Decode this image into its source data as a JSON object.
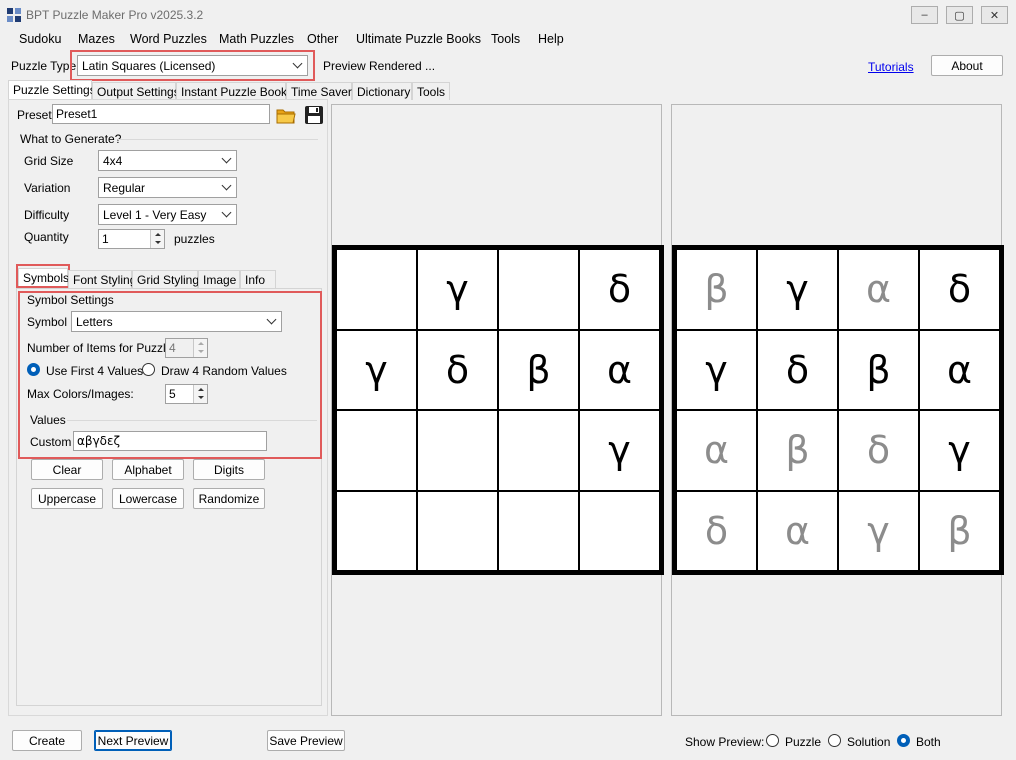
{
  "window": {
    "title": "BPT Puzzle Maker Pro v2025.3.2",
    "minimize": "–",
    "maximize": "▢",
    "close": "✕"
  },
  "menu": [
    "Sudoku",
    "Mazes",
    "Word Puzzles",
    "Math Puzzles",
    "Other",
    "Ultimate Puzzle Books",
    "Tools",
    "Help"
  ],
  "puzzle_type": {
    "label": "Puzzle Type",
    "value": "Latin Squares (Licensed)",
    "status": "Preview Rendered ...",
    "tutorials": "Tutorials",
    "about": "About"
  },
  "main_tabs": [
    "Puzzle Settings",
    "Output Settings",
    "Instant Puzzle Books",
    "Time Saver",
    "Dictionary",
    "Tools"
  ],
  "preset": {
    "label": "Preset",
    "value": "Preset1"
  },
  "generate": {
    "group_title": "What to Generate?",
    "grid_size_label": "Grid Size",
    "grid_size": "4x4",
    "variation_label": "Variation",
    "variation": "Regular",
    "difficulty_label": "Difficulty",
    "difficulty": "Level 1 - Very Easy",
    "quantity_label": "Quantity",
    "quantity": "1",
    "quantity_unit": "puzzles"
  },
  "sub_tabs": [
    "Symbols",
    "Font Styling",
    "Grid Styling",
    "Image",
    "Info"
  ],
  "symbols": {
    "group_title": "Symbol Settings",
    "symbol_label": "Symbol",
    "symbol": "Letters",
    "items_label": "Number of Items for Puzzle:",
    "items": "4",
    "radio_first": "Use First 4 Values",
    "radio_random": "Draw 4 Random Values",
    "max_colors_label": "Max Colors/Images:",
    "max_colors": "5",
    "values_title": "Values",
    "custom_label": "Custom",
    "custom_value": "αβγδεζ"
  },
  "value_buttons": [
    "Clear",
    "Alphabet",
    "Digits",
    "Uppercase",
    "Lowercase",
    "Randomize"
  ],
  "puzzle_grid": [
    [
      "",
      "γ",
      "",
      "δ"
    ],
    [
      "γ",
      "δ",
      "β",
      "α"
    ],
    [
      "",
      "",
      "",
      "γ"
    ],
    [
      "",
      "",
      "",
      ""
    ]
  ],
  "solution_grid": [
    [
      "β",
      "γ",
      "α",
      "δ"
    ],
    [
      "γ",
      "δ",
      "β",
      "α"
    ],
    [
      "α",
      "β",
      "δ",
      "γ"
    ],
    [
      "δ",
      "α",
      "γ",
      "β"
    ]
  ],
  "bottom": {
    "create": "Create",
    "next_preview": "Next Preview",
    "save_preview": "Save Preview",
    "show_preview_label": "Show Preview:",
    "opt_puzzle": "Puzzle",
    "opt_solution": "Solution",
    "opt_both": "Both",
    "selected": "Both"
  },
  "colors": {
    "highlight": "#e05a5a",
    "accent": "#005fb8",
    "link": "#0000ee"
  }
}
